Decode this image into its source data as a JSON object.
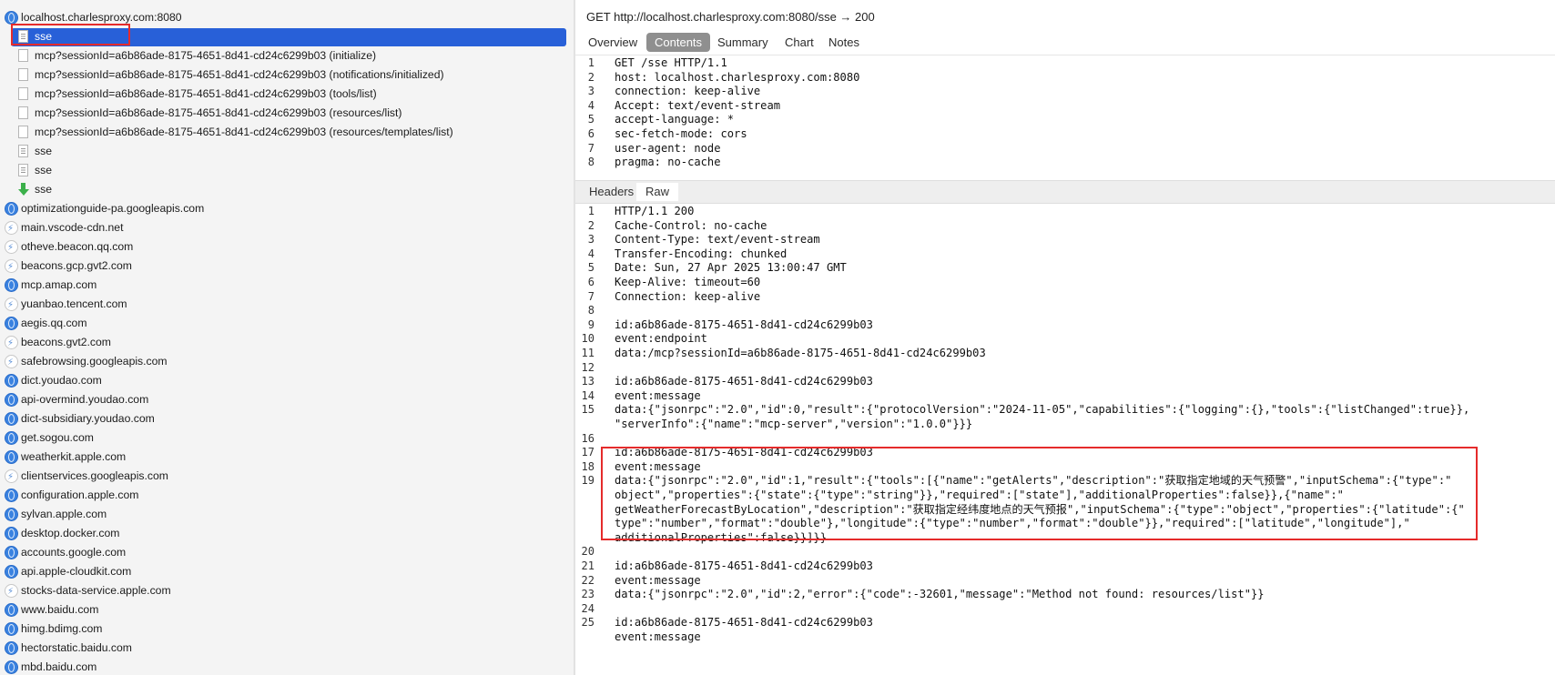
{
  "tree": {
    "host": "localhost.charlesproxy.com:8080",
    "children": [
      {
        "label": "sse",
        "icon": "document-icon",
        "selected": true
      },
      {
        "label": "mcp?sessionId=a6b86ade-8175-4651-8d41-cd24c6299b03 (initialize)",
        "icon": "document-icon"
      },
      {
        "label": "mcp?sessionId=a6b86ade-8175-4651-8d41-cd24c6299b03 (notifications/initialized)",
        "icon": "document-icon"
      },
      {
        "label": "mcp?sessionId=a6b86ade-8175-4651-8d41-cd24c6299b03 (tools/list)",
        "icon": "document-icon"
      },
      {
        "label": "mcp?sessionId=a6b86ade-8175-4651-8d41-cd24c6299b03 (resources/list)",
        "icon": "document-icon"
      },
      {
        "label": "mcp?sessionId=a6b86ade-8175-4651-8d41-cd24c6299b03 (resources/templates/list)",
        "icon": "document-icon"
      },
      {
        "label": "sse",
        "icon": "document-icon"
      },
      {
        "label": "sse",
        "icon": "document-icon"
      },
      {
        "label": "sse",
        "icon": "download-arrow-icon"
      }
    ],
    "hosts": [
      {
        "label": "optimizationguide-pa.googleapis.com",
        "icon": "globe-icon"
      },
      {
        "label": "main.vscode-cdn.net",
        "icon": "lightning-icon"
      },
      {
        "label": "otheve.beacon.qq.com",
        "icon": "lightning-icon"
      },
      {
        "label": "beacons.gcp.gvt2.com",
        "icon": "lightning-icon"
      },
      {
        "label": "mcp.amap.com",
        "icon": "globe-icon"
      },
      {
        "label": "yuanbao.tencent.com",
        "icon": "lightning-icon"
      },
      {
        "label": "aegis.qq.com",
        "icon": "globe-icon"
      },
      {
        "label": "beacons.gvt2.com",
        "icon": "lightning-icon"
      },
      {
        "label": "safebrowsing.googleapis.com",
        "icon": "lightning-icon"
      },
      {
        "label": "dict.youdao.com",
        "icon": "globe-icon"
      },
      {
        "label": "api-overmind.youdao.com",
        "icon": "globe-icon"
      },
      {
        "label": "dict-subsidiary.youdao.com",
        "icon": "globe-icon"
      },
      {
        "label": "get.sogou.com",
        "icon": "globe-icon"
      },
      {
        "label": "weatherkit.apple.com",
        "icon": "globe-icon"
      },
      {
        "label": "clientservices.googleapis.com",
        "icon": "lightning-icon"
      },
      {
        "label": "configuration.apple.com",
        "icon": "globe-icon"
      },
      {
        "label": "sylvan.apple.com",
        "icon": "globe-icon"
      },
      {
        "label": "desktop.docker.com",
        "icon": "globe-icon"
      },
      {
        "label": "accounts.google.com",
        "icon": "globe-icon"
      },
      {
        "label": "api.apple-cloudkit.com",
        "icon": "globe-icon"
      },
      {
        "label": "stocks-data-service.apple.com",
        "icon": "lightning-icon"
      },
      {
        "label": "www.baidu.com",
        "icon": "globe-icon"
      },
      {
        "label": "himg.bdimg.com",
        "icon": "globe-icon"
      },
      {
        "label": "hectorstatic.baidu.com",
        "icon": "globe-icon"
      },
      {
        "label": "mbd.baidu.com",
        "icon": "globe-icon"
      }
    ]
  },
  "detail": {
    "title": "GET http://localhost.charlesproxy.com:8080/sse → 200",
    "tabs": [
      "Overview",
      "Contents",
      "Summary",
      "Chart",
      "Notes"
    ],
    "active_tab": "Contents",
    "request_lines": [
      "GET /sse HTTP/1.1",
      "host: localhost.charlesproxy.com:8080",
      "connection: keep-alive",
      "Accept: text/event-stream",
      "accept-language: *",
      "sec-fetch-mode: cors",
      "user-agent: node",
      "pragma: no-cache"
    ],
    "subtabs": [
      "Headers",
      "Raw"
    ],
    "active_subtab": "Raw",
    "response_lines": [
      {
        "n": "1",
        "t": "HTTP/1.1 200"
      },
      {
        "n": "2",
        "t": "Cache-Control: no-cache"
      },
      {
        "n": "3",
        "t": "Content-Type: text/event-stream"
      },
      {
        "n": "4",
        "t": "Transfer-Encoding: chunked"
      },
      {
        "n": "5",
        "t": "Date: Sun, 27 Apr 2025 13:00:47 GMT"
      },
      {
        "n": "6",
        "t": "Keep-Alive: timeout=60"
      },
      {
        "n": "7",
        "t": "Connection: keep-alive"
      },
      {
        "n": "8",
        "t": ""
      },
      {
        "n": "9",
        "t": "id:a6b86ade-8175-4651-8d41-cd24c6299b03"
      },
      {
        "n": "10",
        "t": "event:endpoint"
      },
      {
        "n": "11",
        "t": "data:/mcp?sessionId=a6b86ade-8175-4651-8d41-cd24c6299b03"
      },
      {
        "n": "12",
        "t": ""
      },
      {
        "n": "13",
        "t": "id:a6b86ade-8175-4651-8d41-cd24c6299b03"
      },
      {
        "n": "14",
        "t": "event:message"
      },
      {
        "n": "15",
        "t": "data:{\"jsonrpc\":\"2.0\",\"id\":0,\"result\":{\"protocolVersion\":\"2024-11-05\",\"capabilities\":{\"logging\":{},\"tools\":{\"listChanged\":true}},"
      },
      {
        "n": "",
        "t": "\"serverInfo\":{\"name\":\"mcp-server\",\"version\":\"1.0.0\"}}}"
      },
      {
        "n": "16",
        "t": ""
      },
      {
        "n": "17",
        "t": "id:a6b86ade-8175-4651-8d41-cd24c6299b03"
      },
      {
        "n": "18",
        "t": "event:message"
      },
      {
        "n": "19",
        "t": "data:{\"jsonrpc\":\"2.0\",\"id\":1,\"result\":{\"tools\":[{\"name\":\"getAlerts\",\"description\":\"获取指定地域的天气预警\",\"inputSchema\":{\"type\":\""
      },
      {
        "n": "",
        "t": "object\",\"properties\":{\"state\":{\"type\":\"string\"}},\"required\":[\"state\"],\"additionalProperties\":false}},{\"name\":\""
      },
      {
        "n": "",
        "t": "getWeatherForecastByLocation\",\"description\":\"获取指定经纬度地点的天气预报\",\"inputSchema\":{\"type\":\"object\",\"properties\":{\"latitude\":{\""
      },
      {
        "n": "",
        "t": "type\":\"number\",\"format\":\"double\"},\"longitude\":{\"type\":\"number\",\"format\":\"double\"}},\"required\":[\"latitude\",\"longitude\"],\""
      },
      {
        "n": "",
        "t": "additionalProperties\":false}}]}}"
      },
      {
        "n": "20",
        "t": ""
      },
      {
        "n": "21",
        "t": "id:a6b86ade-8175-4651-8d41-cd24c6299b03"
      },
      {
        "n": "22",
        "t": "event:message"
      },
      {
        "n": "23",
        "t": "data:{\"jsonrpc\":\"2.0\",\"id\":2,\"error\":{\"code\":-32601,\"message\":\"Method not found: resources/list\"}}"
      },
      {
        "n": "24",
        "t": ""
      },
      {
        "n": "25",
        "t": "id:a6b86ade-8175-4651-8d41-cd24c6299b03"
      },
      {
        "n": "",
        "t": "event:message"
      }
    ]
  }
}
